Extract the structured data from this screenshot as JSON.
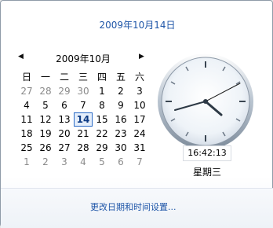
{
  "header": {
    "date_title": "2009年10月14日"
  },
  "calendar": {
    "month_title": "2009年10月",
    "prev_icon": "triangle-left-icon",
    "next_icon": "triangle-right-icon",
    "weekdays": [
      "日",
      "一",
      "二",
      "三",
      "四",
      "五",
      "六"
    ],
    "days": [
      [
        "27",
        "28",
        "29",
        "30",
        "1",
        "2",
        "3"
      ],
      [
        "4",
        "5",
        "6",
        "7",
        "8",
        "9",
        "10"
      ],
      [
        "11",
        "12",
        "13",
        "14",
        "15",
        "16",
        "17"
      ],
      [
        "18",
        "19",
        "20",
        "21",
        "22",
        "23",
        "24"
      ],
      [
        "25",
        "26",
        "27",
        "28",
        "29",
        "30",
        "31"
      ],
      [
        "1",
        "2",
        "3",
        "4",
        "5",
        "6",
        "7"
      ]
    ],
    "selected_day": "14"
  },
  "clock": {
    "time": "16:42:13",
    "weekday": "星期三"
  },
  "footer": {
    "link_text": "更改日期和时间设置..."
  },
  "colors": {
    "link": "#1f56a8",
    "selection_border": "#2a6ac6"
  }
}
